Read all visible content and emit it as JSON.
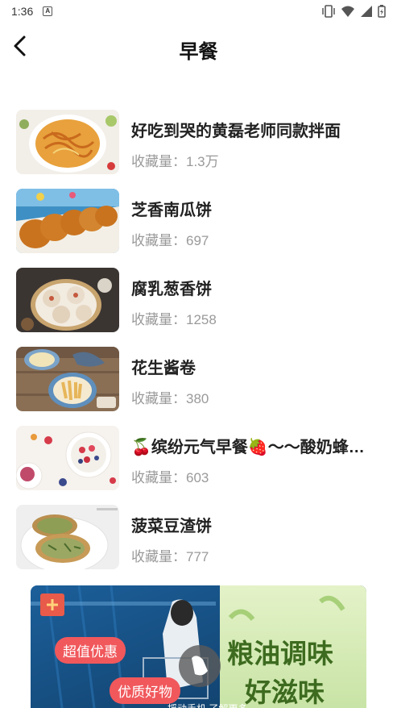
{
  "status": {
    "time": "1:36"
  },
  "header": {
    "title": "早餐"
  },
  "fav_label": "收藏量：",
  "items": [
    {
      "name": "好吃到哭的黄磊老师同款拌面",
      "count": "1.3万"
    },
    {
      "name": "芝香南瓜饼",
      "count": "697"
    },
    {
      "name": "腐乳葱香饼",
      "count": "1258"
    },
    {
      "name": "花生酱卷",
      "count": "380"
    },
    {
      "name": "🍒缤纷元气早餐🍓～～酸奶蜂…",
      "count": "603"
    },
    {
      "name": "菠菜豆渣饼",
      "count": "777"
    }
  ],
  "ad": {
    "headline_1": "粮油调味",
    "headline_2": "好滋味",
    "tag_1": "超值优惠",
    "tag_2": "优质好物",
    "shake_hint": "摇动手机 了解更多"
  }
}
